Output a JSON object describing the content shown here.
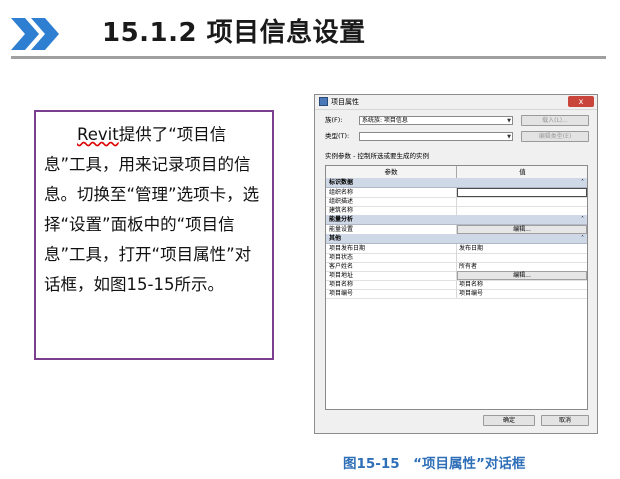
{
  "header": {
    "title": "15.1.2  项目信息设置"
  },
  "description": {
    "text_prefix": "Revit",
    "text_rest": "提供了“项目信息”工具，用来记录项目的信息。切换至“管理”选项卡，选择“设置”面板中的“项目信息”工具，打开“项目属性”对话框，如图15-15所示。"
  },
  "dialog": {
    "title": "项目属性",
    "family_label": "族(F):",
    "family_value": "系统族: 项目信息",
    "load_button": "载入(L)...",
    "type_label": "类型(T):",
    "type_value": "",
    "edit_type_button": "编辑类型(E)",
    "instance_params_label": "实例参数 - 控制所选或要生成的实例",
    "grid_headers": [
      "参数",
      "值"
    ],
    "sections": [
      {
        "name": "标识数据",
        "rows": [
          {
            "param": "组织名称",
            "value": "",
            "kind": "input"
          },
          {
            "param": "组织描述",
            "value": "",
            "kind": "text"
          },
          {
            "param": "建筑名称",
            "value": "",
            "kind": "text"
          }
        ]
      },
      {
        "name": "能量分析",
        "rows": [
          {
            "param": "能量设置",
            "value": "编辑...",
            "kind": "button"
          }
        ]
      },
      {
        "name": "其他",
        "rows": [
          {
            "param": "项目发布日期",
            "value": "发布日期",
            "kind": "text"
          },
          {
            "param": "项目状态",
            "value": "",
            "kind": "text"
          },
          {
            "param": "客户姓名",
            "value": "所有者",
            "kind": "text"
          },
          {
            "param": "项目地址",
            "value": "编辑...",
            "kind": "button"
          },
          {
            "param": "项目名称",
            "value": "项目名称",
            "kind": "text"
          },
          {
            "param": "项目编号",
            "value": "项目编号",
            "kind": "text"
          }
        ]
      }
    ],
    "ok_button": "确定",
    "cancel_button": "取消",
    "close_glyph": "x"
  },
  "caption": "图15-15　“项目属性”对话框",
  "colors": {
    "chevron": "#2e7fd2",
    "textbox_border": "#7a3f8f",
    "caption": "#2f6fb8"
  }
}
